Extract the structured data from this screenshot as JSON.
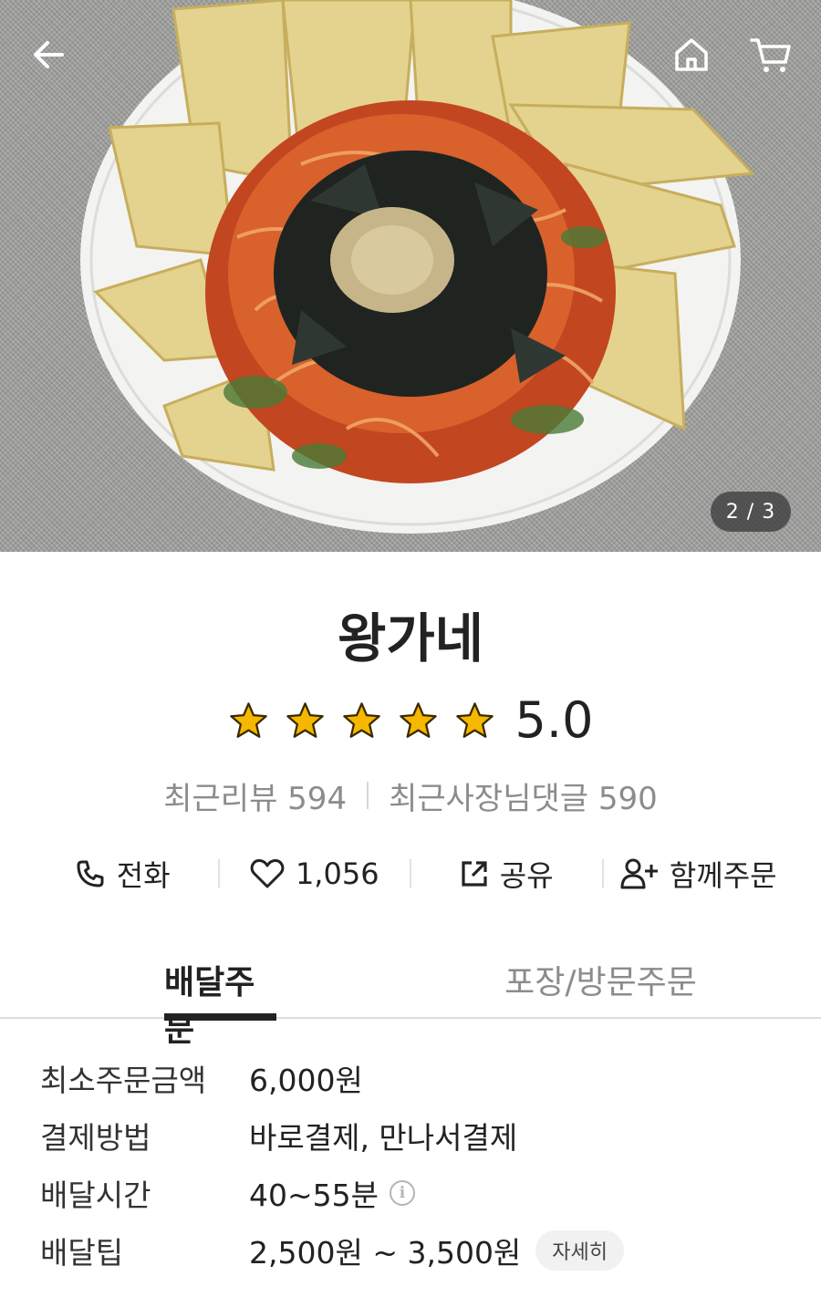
{
  "hero": {
    "image_alt": "food-photo",
    "counter": "2 / 3"
  },
  "store": {
    "name": "왕가네",
    "rating": "5.0",
    "star_count": 5,
    "recent_reviews_label": "최근리뷰 594",
    "owner_replies_label": "최근사장님댓글 590"
  },
  "actions": {
    "call": "전화",
    "like": "1,056",
    "share": "공유",
    "group_order": "함께주문"
  },
  "tabs": {
    "delivery": "배달주문",
    "pickup": "포장/방문주문"
  },
  "info": {
    "min_order": {
      "label": "최소주문금액",
      "value": "6,000원"
    },
    "payment": {
      "label": "결제방법",
      "value": "바로결제, 만나서결제"
    },
    "time": {
      "label": "배달시간",
      "value": "40~55분",
      "icon": "i"
    },
    "tip": {
      "label": "배달팁",
      "value": "2,500원 ~ 3,500원",
      "detail": "자세히"
    }
  },
  "colors": {
    "star": "#f5b700",
    "text": "#222222",
    "muted": "#8c8c8c"
  }
}
